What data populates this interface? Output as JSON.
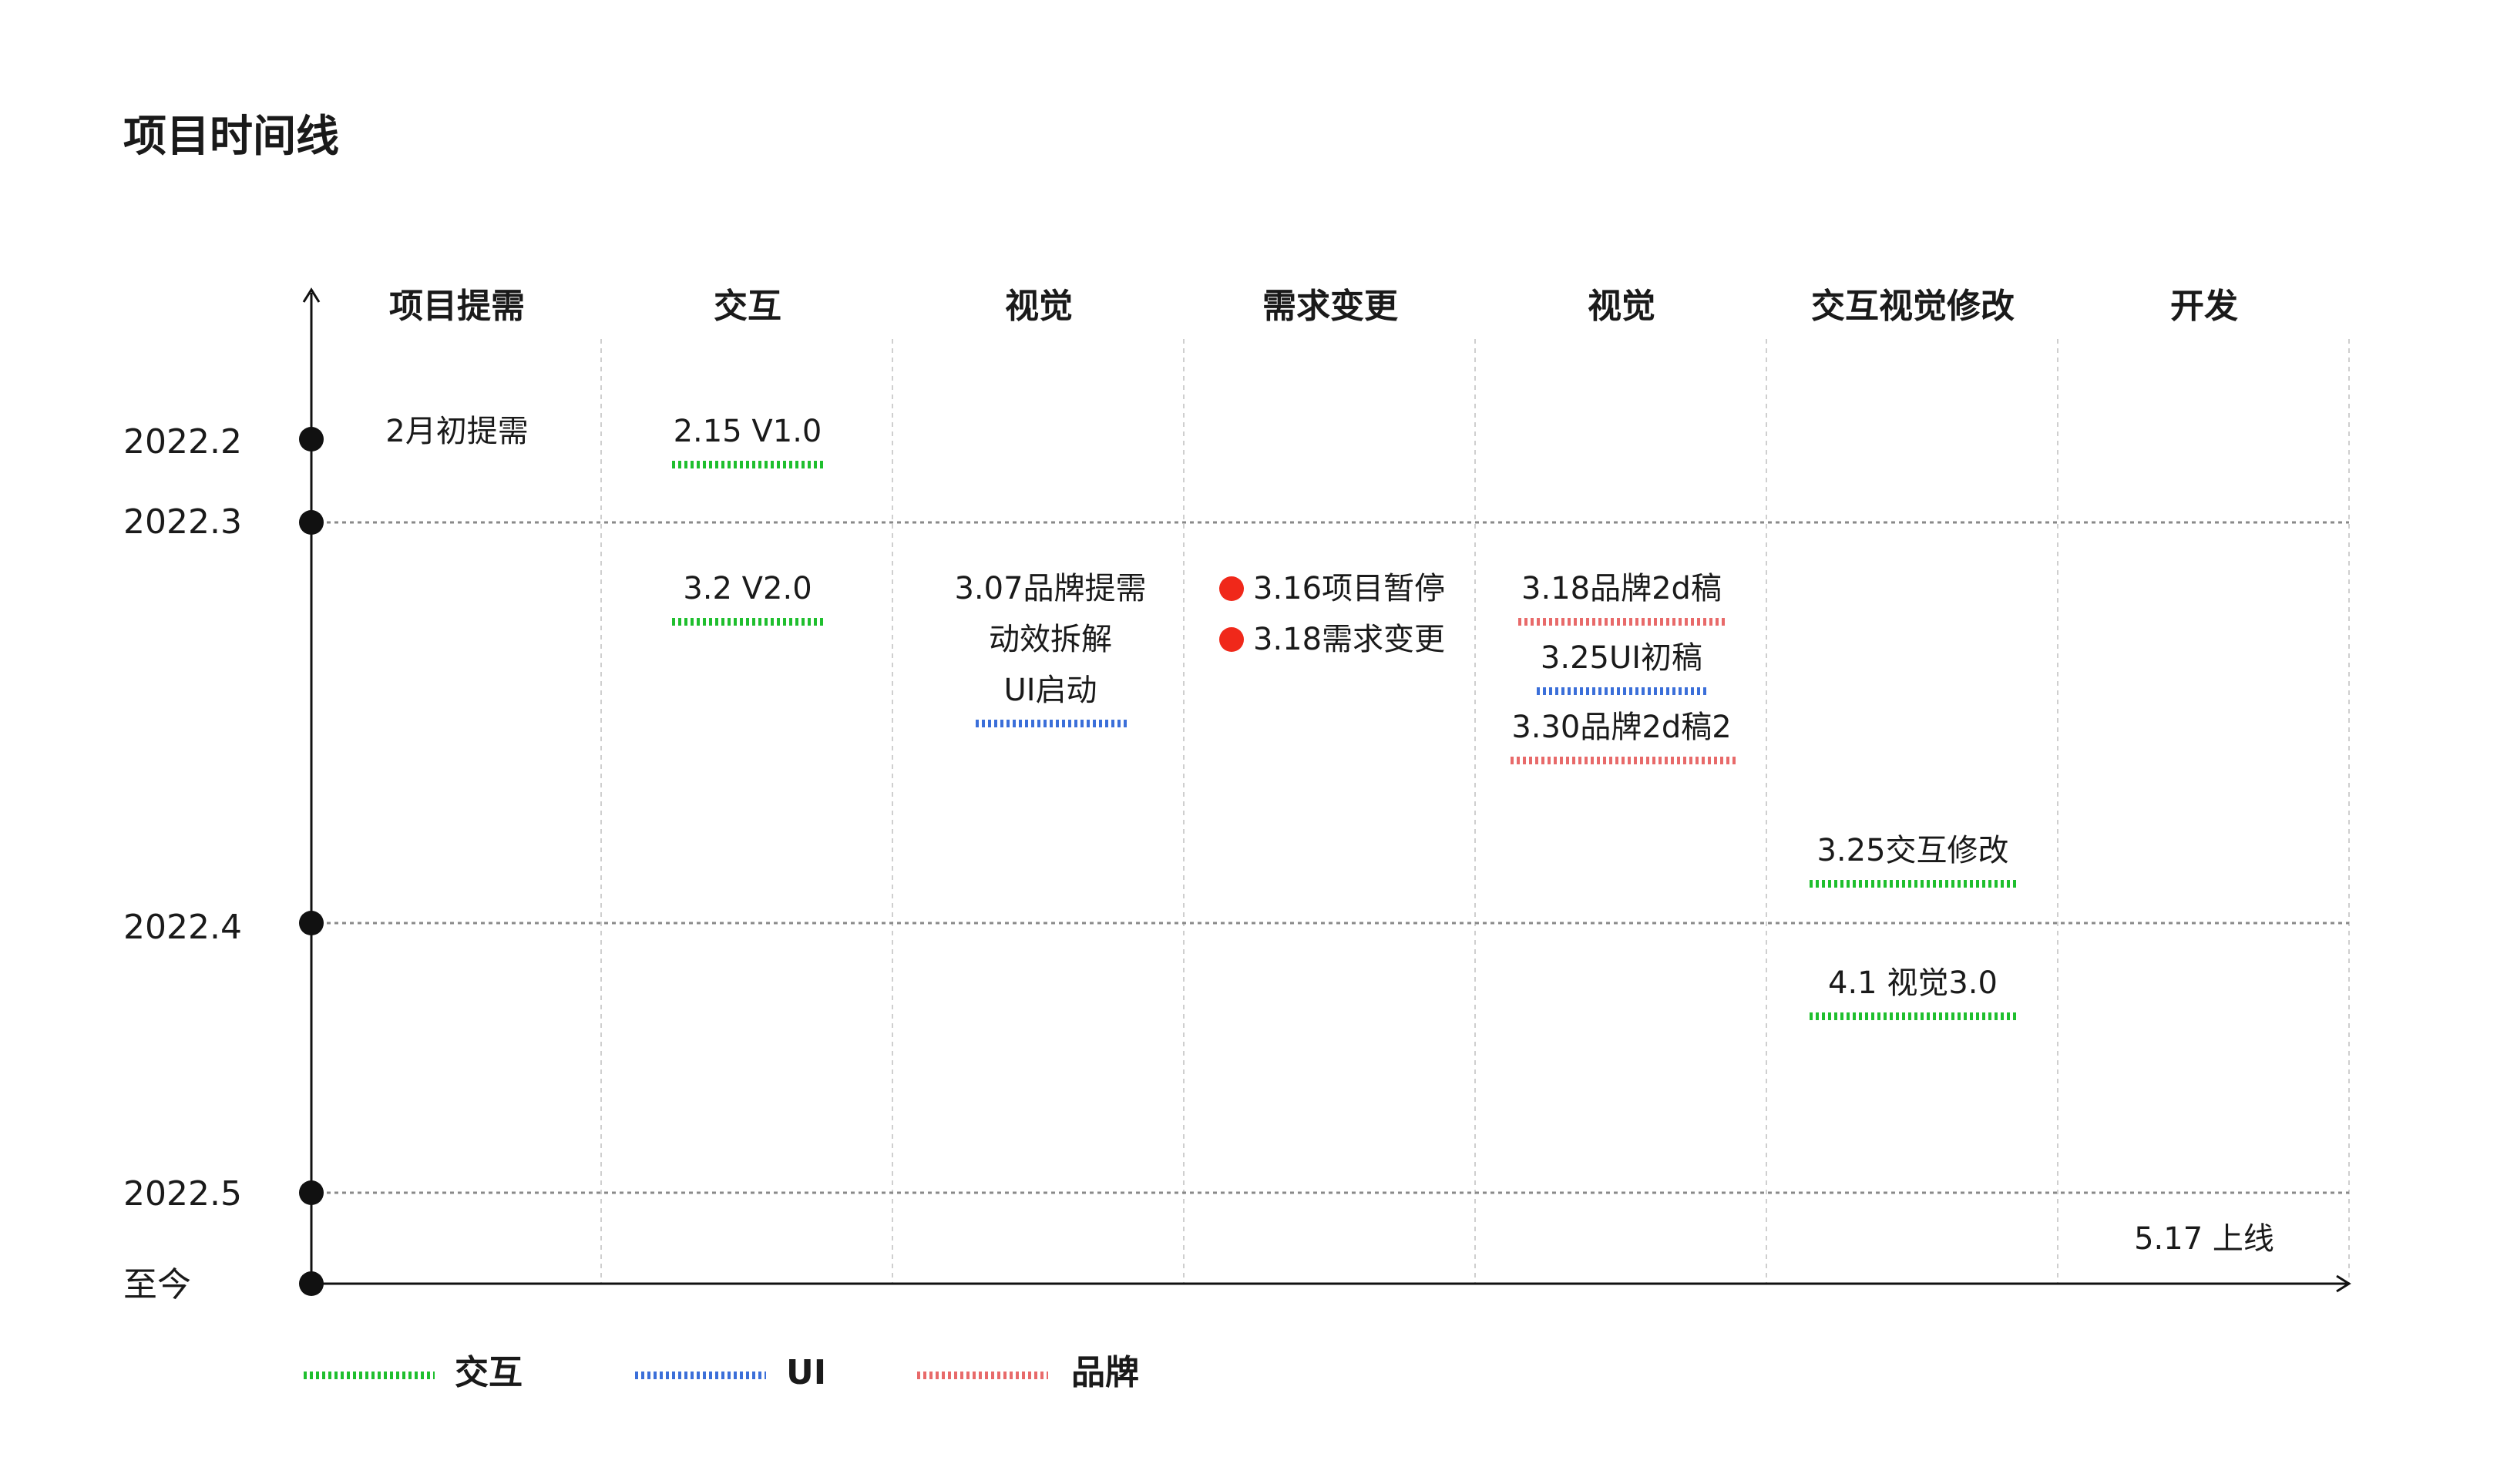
{
  "title": "项目时间线",
  "columns": [
    "项目提需",
    "交互",
    "视觉",
    "需求变更",
    "视觉",
    "交互视觉修改",
    "开发"
  ],
  "dates": [
    "2022.2",
    "2022.3",
    "2022.4",
    "2022.5",
    "至今"
  ],
  "events": {
    "c1_feb": "2月初提需",
    "c2_v1": "2.15 V1.0",
    "c2_v2": "3.2 V2.0",
    "c3_l1": "3.07品牌提需",
    "c3_l2": "动效拆解",
    "c3_l3": "UI启动",
    "c4_l1": "3.16项目暂停",
    "c4_l2": "3.18需求变更",
    "c5_l1": "3.18品牌2d稿",
    "c5_l2": "3.25UI初稿",
    "c5_l3": "3.30品牌2d稿2",
    "c6_l1": "3.25交互修改",
    "c6_l2": "4.1 视觉3.0",
    "c7_l1": "5.17 上线"
  },
  "legend": [
    {
      "label": "交互",
      "color": "#1fbf2e"
    },
    {
      "label": "UI",
      "color": "#3b6fd9"
    },
    {
      "label": "品牌",
      "color": "#e86a6a"
    }
  ],
  "colors": {
    "axis": "#111111",
    "alert": "#f0281a"
  }
}
